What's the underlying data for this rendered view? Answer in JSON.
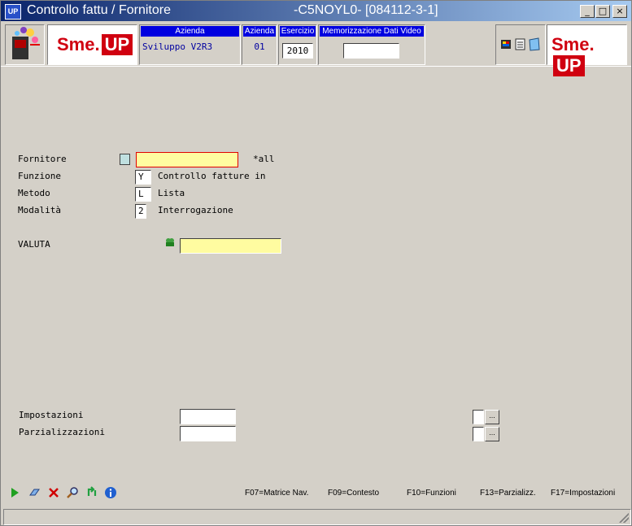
{
  "window": {
    "app_icon": "UP",
    "title_left": "Controllo fattu / Fornitore",
    "title_right": "-C5NOYL0- [084112-3-1]",
    "min_glyph": "_",
    "max_glyph": "□",
    "close_glyph": "×"
  },
  "header": {
    "logo_text": "Sme.",
    "logo_up": "UP",
    "azienda_label": "Azienda",
    "azienda_value": "Sviluppo V2R3",
    "azienda_code_label": "Azienda",
    "azienda_code_value": "01",
    "esercizio_label": "Esercizio",
    "esercizio_value": "2010",
    "memorizzazione_label": "Memorizzazione Dati Video",
    "memorizzazione_value": ""
  },
  "form": {
    "fornitore_label": "Fornitore",
    "fornitore_value": "",
    "fornitore_hint": "*all",
    "funzione_label": "Funzione",
    "funzione_value": "Y",
    "funzione_desc": "Controllo fatture in",
    "metodo_label": "Metodo",
    "metodo_value": "L",
    "metodo_desc": "Lista",
    "modalita_label": "Modalità",
    "modalita_value": "2",
    "modalita_desc": "Interrogazione",
    "valuta_label": "VALUTA",
    "valuta_value": "",
    "impostazioni_label": "Impostazioni",
    "impostazioni_value": "",
    "parzializzazioni_label": "Parzializzazioni",
    "parzializzazioni_value": "",
    "ellipsis": "..."
  },
  "footer": {
    "fkeys": [
      "F07=Matrice Nav.",
      "F09=Contesto",
      "F10=Funzioni",
      "F13=Parzializz.",
      "F17=Impostazioni"
    ],
    "icons": [
      "play-icon",
      "eraser-icon",
      "cancel-icon",
      "search-icon",
      "refresh-icon",
      "info-icon"
    ]
  },
  "colors": {
    "title_gradient_start": "#0a246a",
    "title_gradient_end": "#a6caf0",
    "header_label_bg": "#0000e0",
    "input_highlight": "#fffca0",
    "brand_red": "#d00010"
  }
}
